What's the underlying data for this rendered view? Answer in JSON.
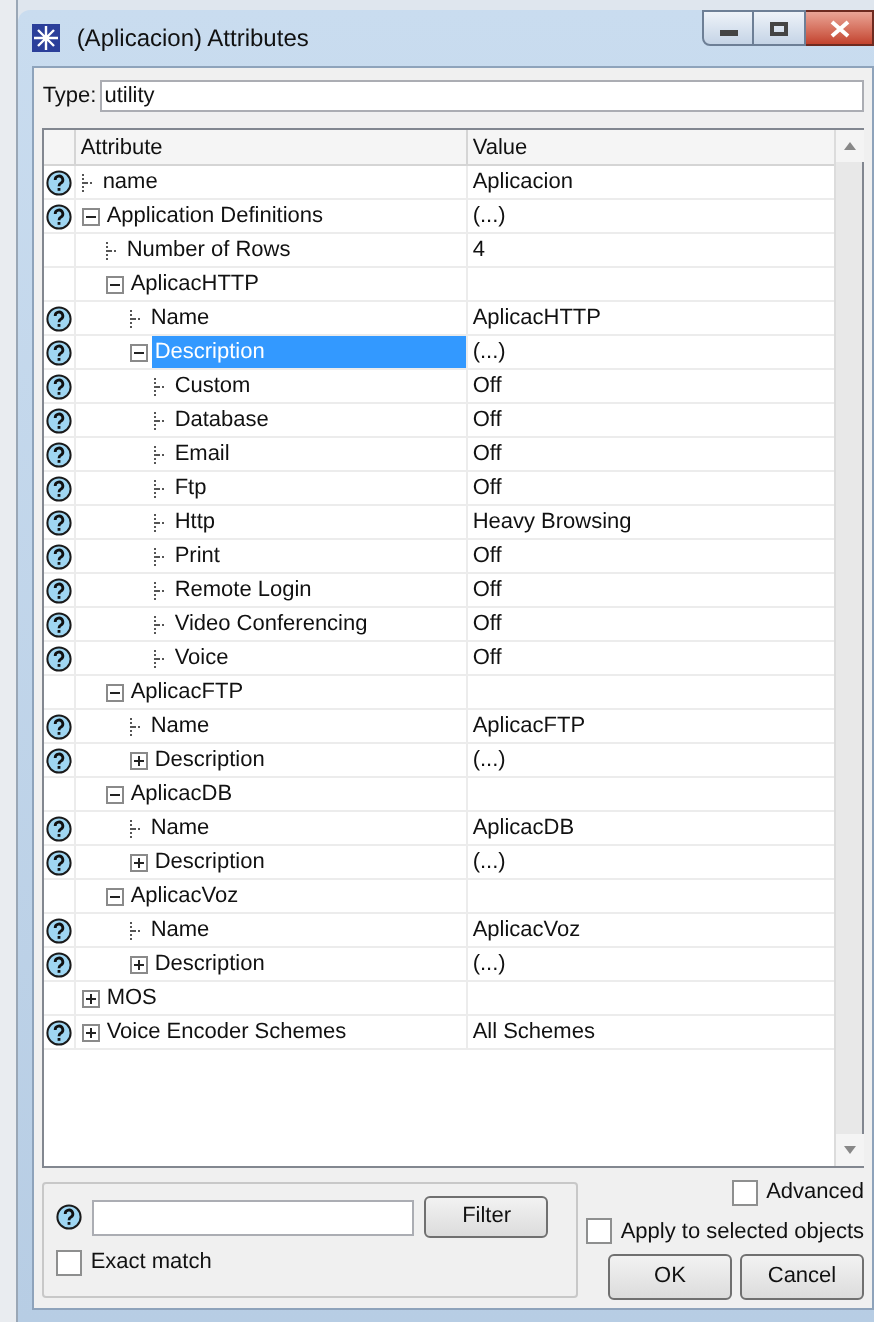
{
  "window": {
    "title": "(Aplicacion) Attributes"
  },
  "type_field": {
    "label": "Type:",
    "value": "utility"
  },
  "table": {
    "columns": [
      "Attribute",
      "Value"
    ],
    "rows": [
      {
        "attribute": "name",
        "value": "Aplicacion",
        "help": true,
        "selected": false
      },
      {
        "attribute": "Application Definitions",
        "value": "(...)",
        "help": true,
        "selected": false,
        "expanded": true,
        "children": [
          {
            "attribute": "Number of Rows",
            "value": "4",
            "help": false,
            "selected": false
          },
          {
            "attribute": "AplicacHTTP",
            "help": false,
            "selected": false,
            "expanded": true,
            "children": [
              {
                "attribute": "Name",
                "value": "AplicacHTTP",
                "help": true,
                "selected": false
              },
              {
                "attribute": "Description",
                "value": "(...)",
                "help": true,
                "selected": true,
                "expanded": true,
                "children": [
                  {
                    "attribute": "Custom",
                    "value": "Off",
                    "help": true,
                    "selected": false
                  },
                  {
                    "attribute": "Database",
                    "value": "Off",
                    "help": true,
                    "selected": false
                  },
                  {
                    "attribute": "Email",
                    "value": "Off",
                    "help": true,
                    "selected": false
                  },
                  {
                    "attribute": "Ftp",
                    "value": "Off",
                    "help": true,
                    "selected": false
                  },
                  {
                    "attribute": "Http",
                    "value": "Heavy Browsing",
                    "help": true,
                    "selected": false
                  },
                  {
                    "attribute": "Print",
                    "value": "Off",
                    "help": true,
                    "selected": false
                  },
                  {
                    "attribute": "Remote Login",
                    "value": "Off",
                    "help": true,
                    "selected": false
                  },
                  {
                    "attribute": "Video Conferencing",
                    "value": "Off",
                    "help": true,
                    "selected": false
                  },
                  {
                    "attribute": "Voice",
                    "value": "Off",
                    "help": true,
                    "selected": false
                  }
                ]
              }
            ]
          },
          {
            "attribute": "AplicacFTP",
            "help": false,
            "selected": false,
            "expanded": true,
            "children": [
              {
                "attribute": "Name",
                "value": "AplicacFTP",
                "help": true,
                "selected": false
              },
              {
                "attribute": "Description",
                "value": "(...)",
                "help": true,
                "selected": false,
                "expanded": false
              }
            ]
          },
          {
            "attribute": "AplicacDB",
            "help": false,
            "selected": false,
            "expanded": true,
            "children": [
              {
                "attribute": "Name",
                "value": "AplicacDB",
                "help": true,
                "selected": false
              },
              {
                "attribute": "Description",
                "value": "(...)",
                "help": true,
                "selected": false,
                "expanded": false
              }
            ]
          },
          {
            "attribute": "AplicacVoz",
            "help": false,
            "selected": false,
            "expanded": true,
            "children": [
              {
                "attribute": "Name",
                "value": "AplicacVoz",
                "help": true,
                "selected": false
              },
              {
                "attribute": "Description",
                "value": "(...)",
                "help": true,
                "selected": false,
                "expanded": false
              }
            ]
          }
        ]
      },
      {
        "attribute": "MOS",
        "help": false,
        "selected": false,
        "expanded": false
      },
      {
        "attribute": "Voice Encoder Schemes",
        "value": "All Schemes",
        "help": true,
        "selected": false,
        "expanded": false
      }
    ]
  },
  "filter": {
    "button": "Filter",
    "exact_match": {
      "label": "Exact match",
      "checked": false
    }
  },
  "advanced": {
    "label": "Advanced",
    "checked": false
  },
  "apply_selected": {
    "label": "Apply to selected objects",
    "checked": false
  },
  "buttons": [
    "OK",
    "Cancel"
  ]
}
